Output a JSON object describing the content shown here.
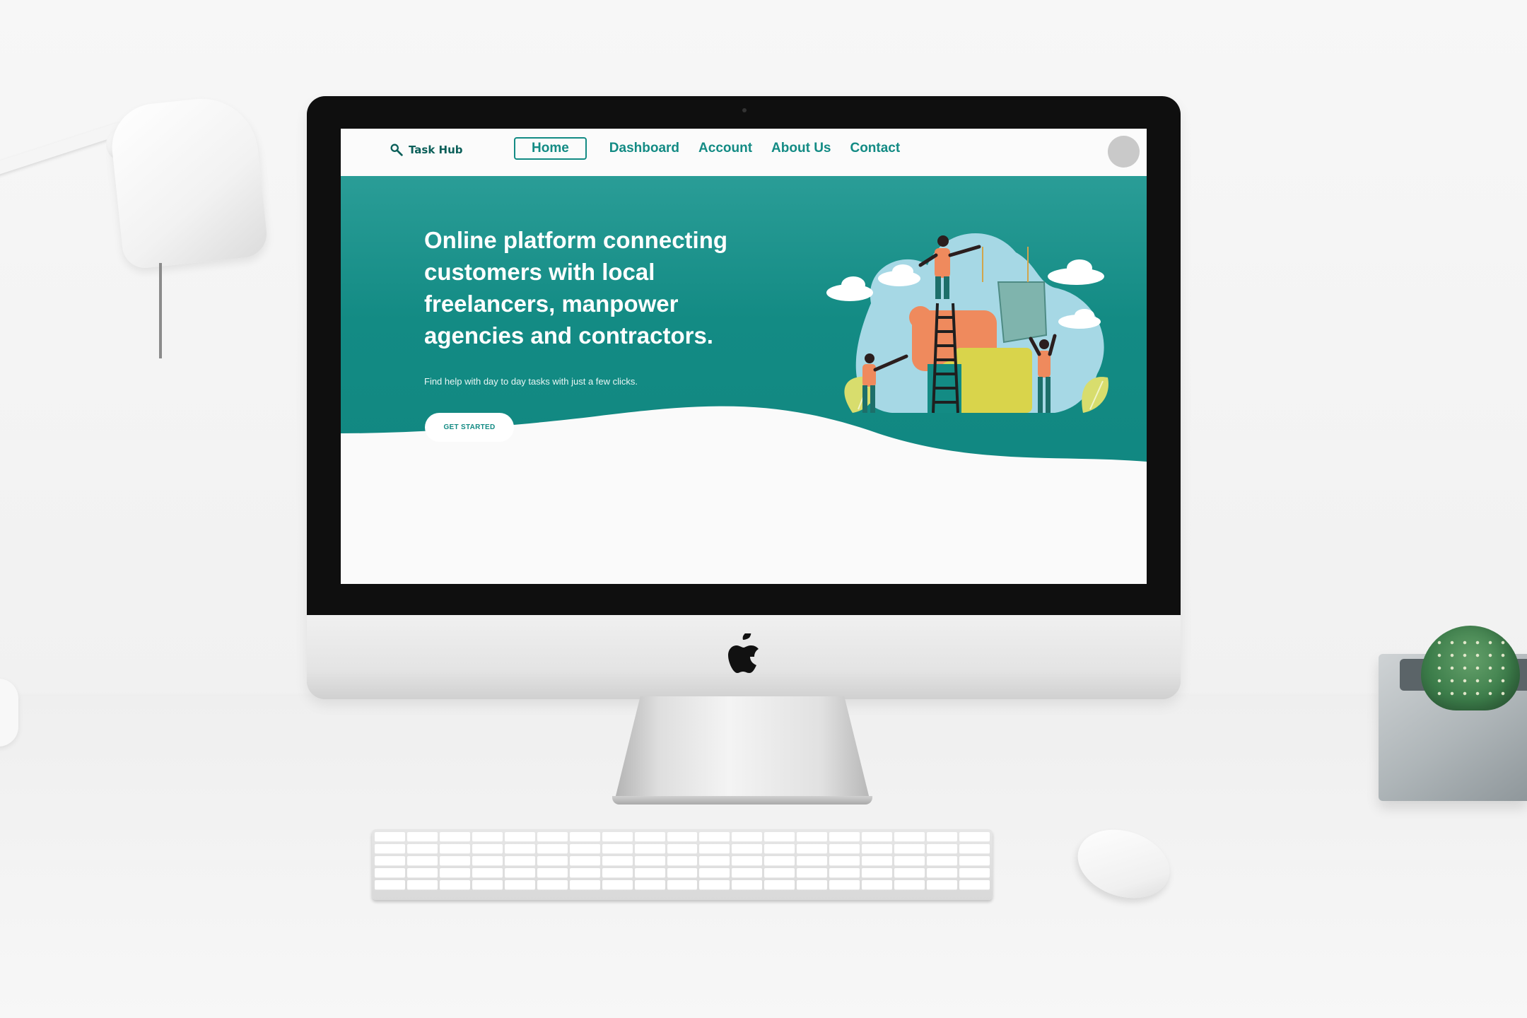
{
  "app": {
    "brand": "Task Hub"
  },
  "nav": {
    "items": [
      {
        "label": "Home",
        "active": true
      },
      {
        "label": "Dashboard",
        "active": false
      },
      {
        "label": "Account",
        "active": false
      },
      {
        "label": "About Us",
        "active": false
      },
      {
        "label": "Contact",
        "active": false
      }
    ]
  },
  "hero": {
    "title": "Online platform connecting customers with local freelancers, manpower agencies and contractors.",
    "subtitle": "Find help with day to day tasks with just a few clicks.",
    "cta_label": "GET STARTED"
  },
  "icons": {
    "brand": "search-icon",
    "avatar": "avatar-icon",
    "device_logo": "apple-logo-icon"
  },
  "colors": {
    "primary": "#138b84",
    "primary_dark": "#0f857f",
    "background": "#fafafa",
    "accent_orange": "#ef8a5d",
    "accent_yellow": "#d9d44b"
  }
}
